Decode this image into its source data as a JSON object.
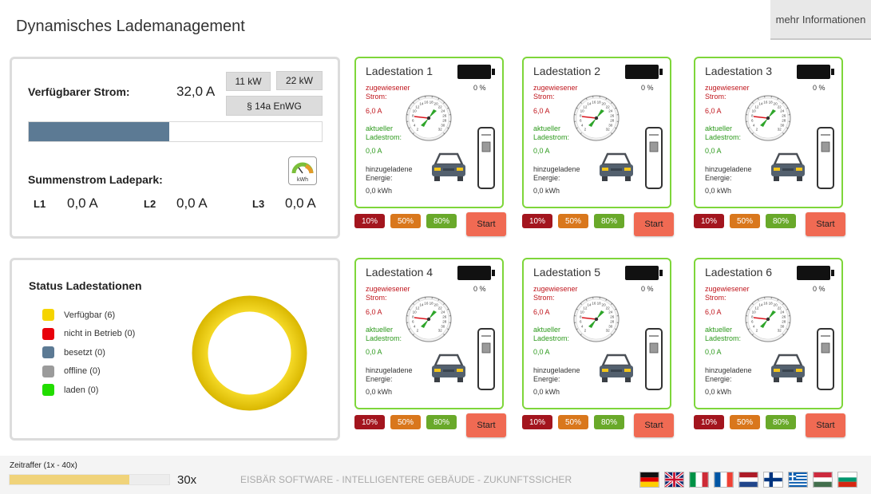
{
  "header": {
    "title": "Dynamisches Lademanagement",
    "more_info": "mehr Informationen"
  },
  "power": {
    "available_label": "Verfügbarer Strom:",
    "available_value": "32,0 A",
    "btn_11kw": "11 kW",
    "btn_22kw": "22 kW",
    "btn_enwg": "§ 14a EnWG",
    "usage_fraction": 0.48,
    "sum_label": "Summenstrom Ladepark:",
    "kwh_icon_label": "kWh",
    "phases": [
      {
        "label": "L1",
        "value": "0,0 A"
      },
      {
        "label": "L2",
        "value": "0,0 A"
      },
      {
        "label": "L3",
        "value": "0,0 A"
      }
    ]
  },
  "status": {
    "title": "Status Ladestationen",
    "legend": [
      {
        "label": "Verfügbar (6)",
        "color": "#f5d400"
      },
      {
        "label": "nicht in Betrieb (0)",
        "color": "#e8000b"
      },
      {
        "label": "besetzt (0)",
        "color": "#5c7a94"
      },
      {
        "label": "offline (0)",
        "color": "#9b9b9b"
      },
      {
        "label": "laden (0)",
        "color": "#22dd00"
      }
    ],
    "donut_fractions": {
      "available": 1.0
    }
  },
  "station_labels": {
    "assigned_1": "zugewiesener",
    "assigned_2": "Strom:",
    "current_1": "aktueller",
    "current_2": "Ladestrom:",
    "energy_1": "hinzugeladene",
    "energy_2": "Energie:",
    "p10": "10%",
    "p50": "50%",
    "p80": "80%",
    "start": "Start"
  },
  "stations": [
    {
      "name": "Ladestation 1",
      "battery": "0 %",
      "assigned": "6,0 A",
      "current": "0,0 A",
      "energy": "0,0 kWh"
    },
    {
      "name": "Ladestation 2",
      "battery": "0 %",
      "assigned": "6,0 A",
      "current": "0,0 A",
      "energy": "0,0 kWh"
    },
    {
      "name": "Ladestation 3",
      "battery": "0 %",
      "assigned": "6,0 A",
      "current": "0,0 A",
      "energy": "0,0 kWh"
    },
    {
      "name": "Ladestation 4",
      "battery": "0 %",
      "assigned": "6,0 A",
      "current": "0,0 A",
      "energy": "0,0 kWh"
    },
    {
      "name": "Ladestation 5",
      "battery": "0 %",
      "assigned": "6,0 A",
      "current": "0,0 A",
      "energy": "0,0 kWh"
    },
    {
      "name": "Ladestation 6",
      "battery": "0 %",
      "assigned": "6,0 A",
      "current": "0,0 A",
      "energy": "0,0 kWh"
    }
  ],
  "gauge_ticks": [
    "2",
    "4",
    "6",
    "8",
    "10",
    "12",
    "14",
    "16",
    "18",
    "20",
    "22",
    "24",
    "26",
    "28",
    "30",
    "32"
  ],
  "footer": {
    "timelapse_label": "Zeitraffer (1x - 40x)",
    "timelapse_fraction": 0.75,
    "timelapse_value": "30x",
    "slogan": "EISBÄR SOFTWARE - INTELLIGENTERE GEBÄUDE - ZUKUNFTSSICHER",
    "flags": [
      "flag-de-icon",
      "flag-gb-icon",
      "flag-it-icon",
      "flag-fr-icon",
      "flag-nl-icon",
      "flag-fi-icon",
      "flag-gr-icon",
      "flag-hu-icon",
      "flag-bg-icon"
    ]
  }
}
